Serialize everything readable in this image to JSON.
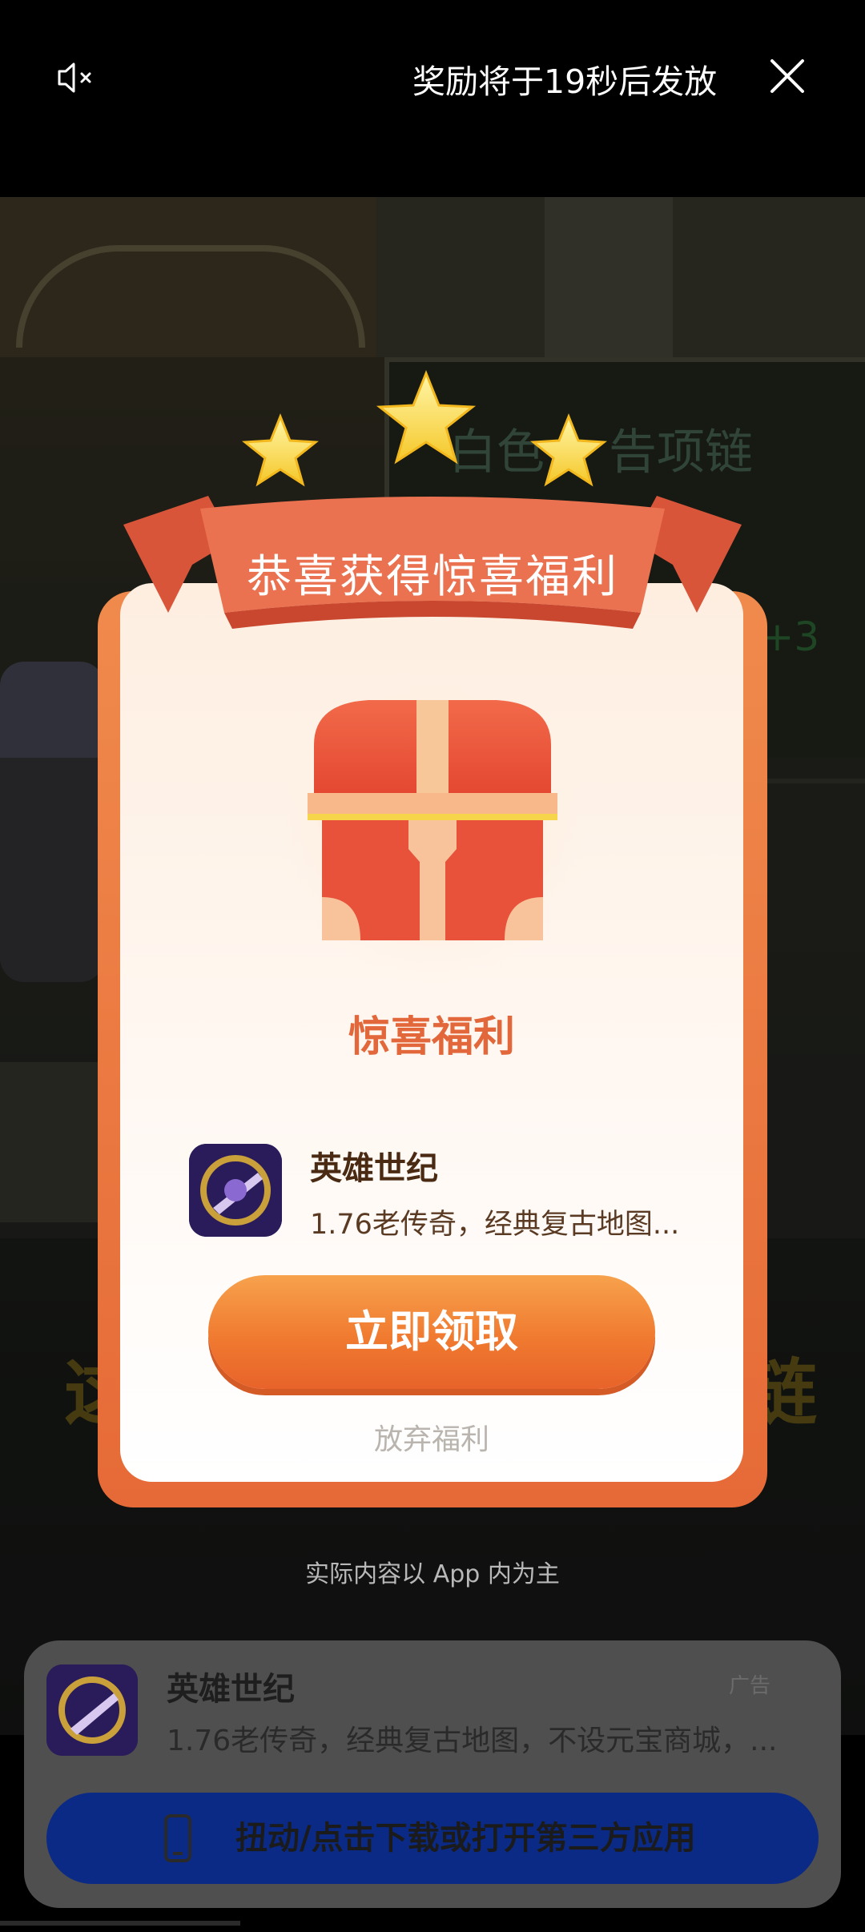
{
  "topbar": {
    "countdown_text": "奖励将于19秒后发放",
    "mute_icon": "speaker-muted-icon",
    "close_icon": "close-icon"
  },
  "popup": {
    "ribbon_title": "恭喜获得惊喜福利",
    "subtitle": "惊喜福利",
    "app": {
      "name": "英雄世纪",
      "description": "1.76老传奇，经典复古地图..."
    },
    "claim_button": "立即领取",
    "give_up_link": "放弃福利",
    "stars_count": 3
  },
  "disclaimer": "实际内容以 App 内为主",
  "ad_card": {
    "app_name": "英雄世纪",
    "description": "1.76老传奇，经典复古地图，不设元宝商城，...",
    "badge": "广告",
    "action_button": "扭动/点击下载或打开第三方应用"
  },
  "colors": {
    "card_border": "#e66a37",
    "subtitle": "#e2683b",
    "claim_button": "#f07a30",
    "ad_button": "#0b2a86"
  }
}
